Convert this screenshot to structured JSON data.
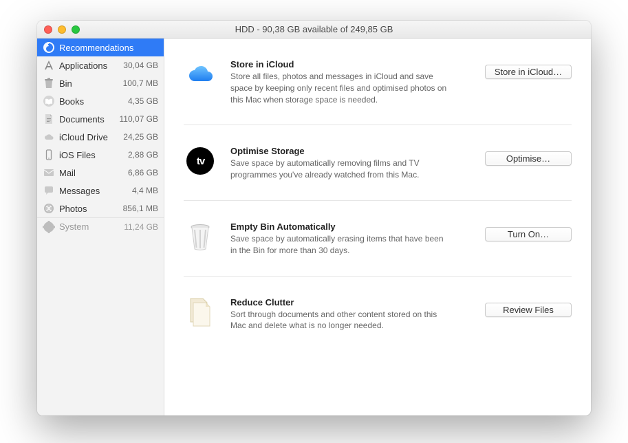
{
  "window": {
    "title": "HDD - 90,38 GB available of 249,85 GB"
  },
  "sidebar": {
    "items": [
      {
        "label": "Recommendations",
        "size": ""
      },
      {
        "label": "Applications",
        "size": "30,04 GB"
      },
      {
        "label": "Bin",
        "size": "100,7 MB"
      },
      {
        "label": "Books",
        "size": "4,35 GB"
      },
      {
        "label": "Documents",
        "size": "110,07 GB"
      },
      {
        "label": "iCloud Drive",
        "size": "24,25 GB"
      },
      {
        "label": "iOS Files",
        "size": "2,88 GB"
      },
      {
        "label": "Mail",
        "size": "6,86 GB"
      },
      {
        "label": "Messages",
        "size": "4,4 MB"
      },
      {
        "label": "Photos",
        "size": "856,1 MB"
      },
      {
        "label": "System",
        "size": "11,24 GB"
      }
    ]
  },
  "recs": [
    {
      "title": "Store in iCloud",
      "desc": "Store all files, photos and messages in iCloud and save space by keeping only recent files and optimised photos on this Mac when storage space is needed.",
      "button": "Store in iCloud…"
    },
    {
      "title": "Optimise Storage",
      "desc": "Save space by automatically removing films and TV programmes you've already watched from this Mac.",
      "button": "Optimise…"
    },
    {
      "title": "Empty Bin Automatically",
      "desc": "Save space by automatically erasing items that have been in the Bin for more than 30 days.",
      "button": "Turn On…"
    },
    {
      "title": "Reduce Clutter",
      "desc": "Sort through documents and other content stored on this Mac and delete what is no longer needed.",
      "button": "Review Files"
    }
  ]
}
